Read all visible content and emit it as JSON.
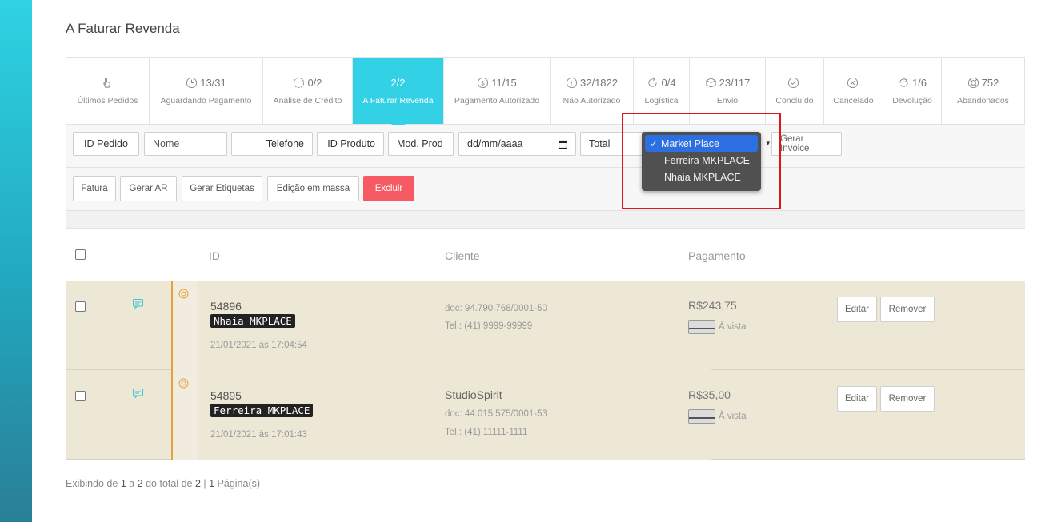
{
  "page": {
    "title": "A Faturar Revenda"
  },
  "status_tabs": [
    {
      "count": "",
      "label": "Últimos Pedidos",
      "icon": "hand-pointer-icon"
    },
    {
      "count": "13/31",
      "label": "Aguardando Pagamento",
      "icon": "clock-icon"
    },
    {
      "count": "0/2",
      "label": "Análise de Crédito",
      "icon": "spinner-circle-icon"
    },
    {
      "count": "2/2",
      "label": "A Faturar Revenda",
      "icon": "",
      "active": true
    },
    {
      "count": "11/15",
      "label": "Pagamento Autorizado",
      "icon": "dollar-circle-icon"
    },
    {
      "count": "32/1822",
      "label": "Não Autorizado",
      "icon": "alert-circle-icon"
    },
    {
      "count": "0/4",
      "label": "Logística",
      "icon": "refresh-icon"
    },
    {
      "count": "23/117",
      "label": "Envio",
      "icon": "box-icon"
    },
    {
      "count": "",
      "label": "Concluído",
      "icon": "check-circle-icon"
    },
    {
      "count": "",
      "label": "Cancelado",
      "icon": "x-circle-icon"
    },
    {
      "count": "1/6",
      "label": "Devolução",
      "icon": "return-arrows-icon"
    },
    {
      "count": "752",
      "label": "Abandonados",
      "icon": "lifebuoy-icon"
    }
  ],
  "filters": {
    "id_pedido": "ID Pedido",
    "nome": "Nome",
    "telefone": "Telefone",
    "id_produto": "ID Produto",
    "mod_prod": "Mod. Prod",
    "date_placeholder": "dd/mm/aaaa",
    "total": "Total",
    "gerar_invoice": "Gerar Invoice"
  },
  "dropdown": {
    "options": [
      "Market Place",
      "Ferreira MKPLACE",
      "Nhaia MKPLACE"
    ],
    "selected": "Market Place",
    "check": "✓"
  },
  "actions": {
    "fatura": "Fatura",
    "gerar_ar": "Gerar AR",
    "gerar_etiquetas": "Gerar Etiquetas",
    "edicao": "Edição em massa",
    "excluir": "Excluir"
  },
  "table": {
    "headers": {
      "id": "ID",
      "cliente": "Cliente",
      "pagamento": "Pagamento"
    },
    "rows": [
      {
        "id": "54896",
        "store": "Nhaia MKPLACE",
        "date": "21/01/2021 às 17:04:54",
        "client_name": "",
        "doc": "doc: 94.790.768/0001-50",
        "tel": "Tel.: (41) 9999-99999",
        "value": "R$243,75",
        "payment": "À vista",
        "edit": "Editar",
        "remove": "Remover"
      },
      {
        "id": "54895",
        "store": "Ferreira MKPLACE",
        "date": "21/01/2021 às 17:01:43",
        "client_name": "StudioSpirit",
        "doc": "doc: 44.015.575/0001-53",
        "tel": "Tel.: (41) 11111-1111",
        "value": "R$35,00",
        "payment": "À vista",
        "edit": "Editar",
        "remove": "Remover"
      }
    ]
  },
  "footer": {
    "prefix": "Exibindo de ",
    "from": "1",
    "a": " a ",
    "to": "2",
    "mid": " do total de ",
    "total": "2",
    "sep": " | ",
    "pages": "1",
    "suffix": " Página(s)"
  },
  "colors": {
    "accent": "#33d1e5",
    "danger": "#f65b63",
    "row_bg": "#ede7d6",
    "highlight": "#e0141b"
  }
}
